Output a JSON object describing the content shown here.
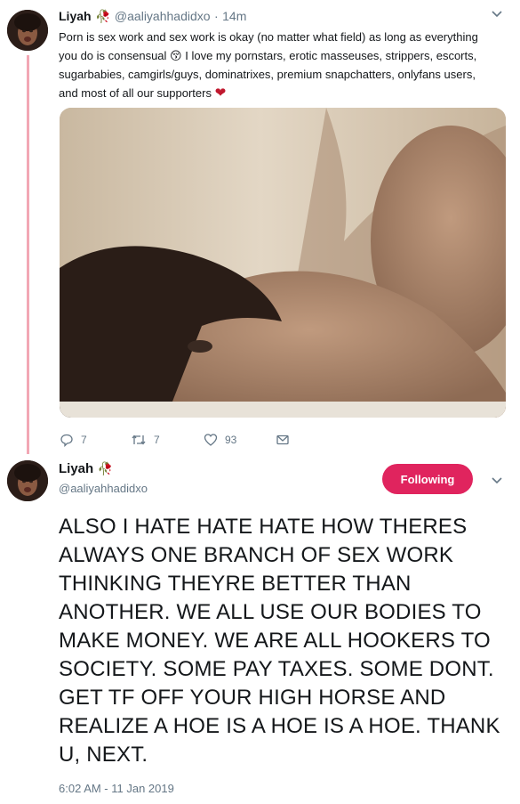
{
  "tweet1": {
    "name": "Liyah",
    "badge_emoji": "🥀",
    "handle": "@aaliyahhadidxo",
    "separator": "·",
    "time": "14m",
    "text_line1": "Porn is sex work and sex work is okay (no matter what field) as long as everything",
    "text_line2a": "you do is consensual",
    "inline_emoji": "😚",
    "text_line2b": "I love my pornstars, erotic masseuses, strippers, escorts,",
    "text_line3": "sugarbabies, camgirls/guys, dominatrixes, premium snapchatters, onlyfans users,",
    "text_line4": "and most of all our supporters",
    "end_emoji": "❤",
    "actions": {
      "reply_count": "7",
      "retweet_count": "7",
      "like_count": "93"
    }
  },
  "tweet2": {
    "name": "Liyah",
    "badge_emoji": "🥀",
    "handle": "@aaliyahhadidxo",
    "follow_label": "Following",
    "text": "ALSO I HATE HATE HATE HOW THERES ALWAYS ONE BRANCH OF SEX WORK THINKING THEYRE BETTER THAN ANOTHER. WE ALL USE OUR BODIES TO MAKE MONEY. WE ARE ALL HOOKERS TO SOCIETY. SOME PAY TAXES. SOME DONT. GET TF OFF YOUR HIGH HORSE AND REALIZE A HOE IS A HOE IS A HOE. THANK U, NEXT.",
    "timestamp": "6:02 AM - 11 Jan 2019"
  },
  "colors": {
    "follow_button": "#e0245e",
    "thread_line": "#f2a7b4",
    "secondary_text": "#657786"
  }
}
